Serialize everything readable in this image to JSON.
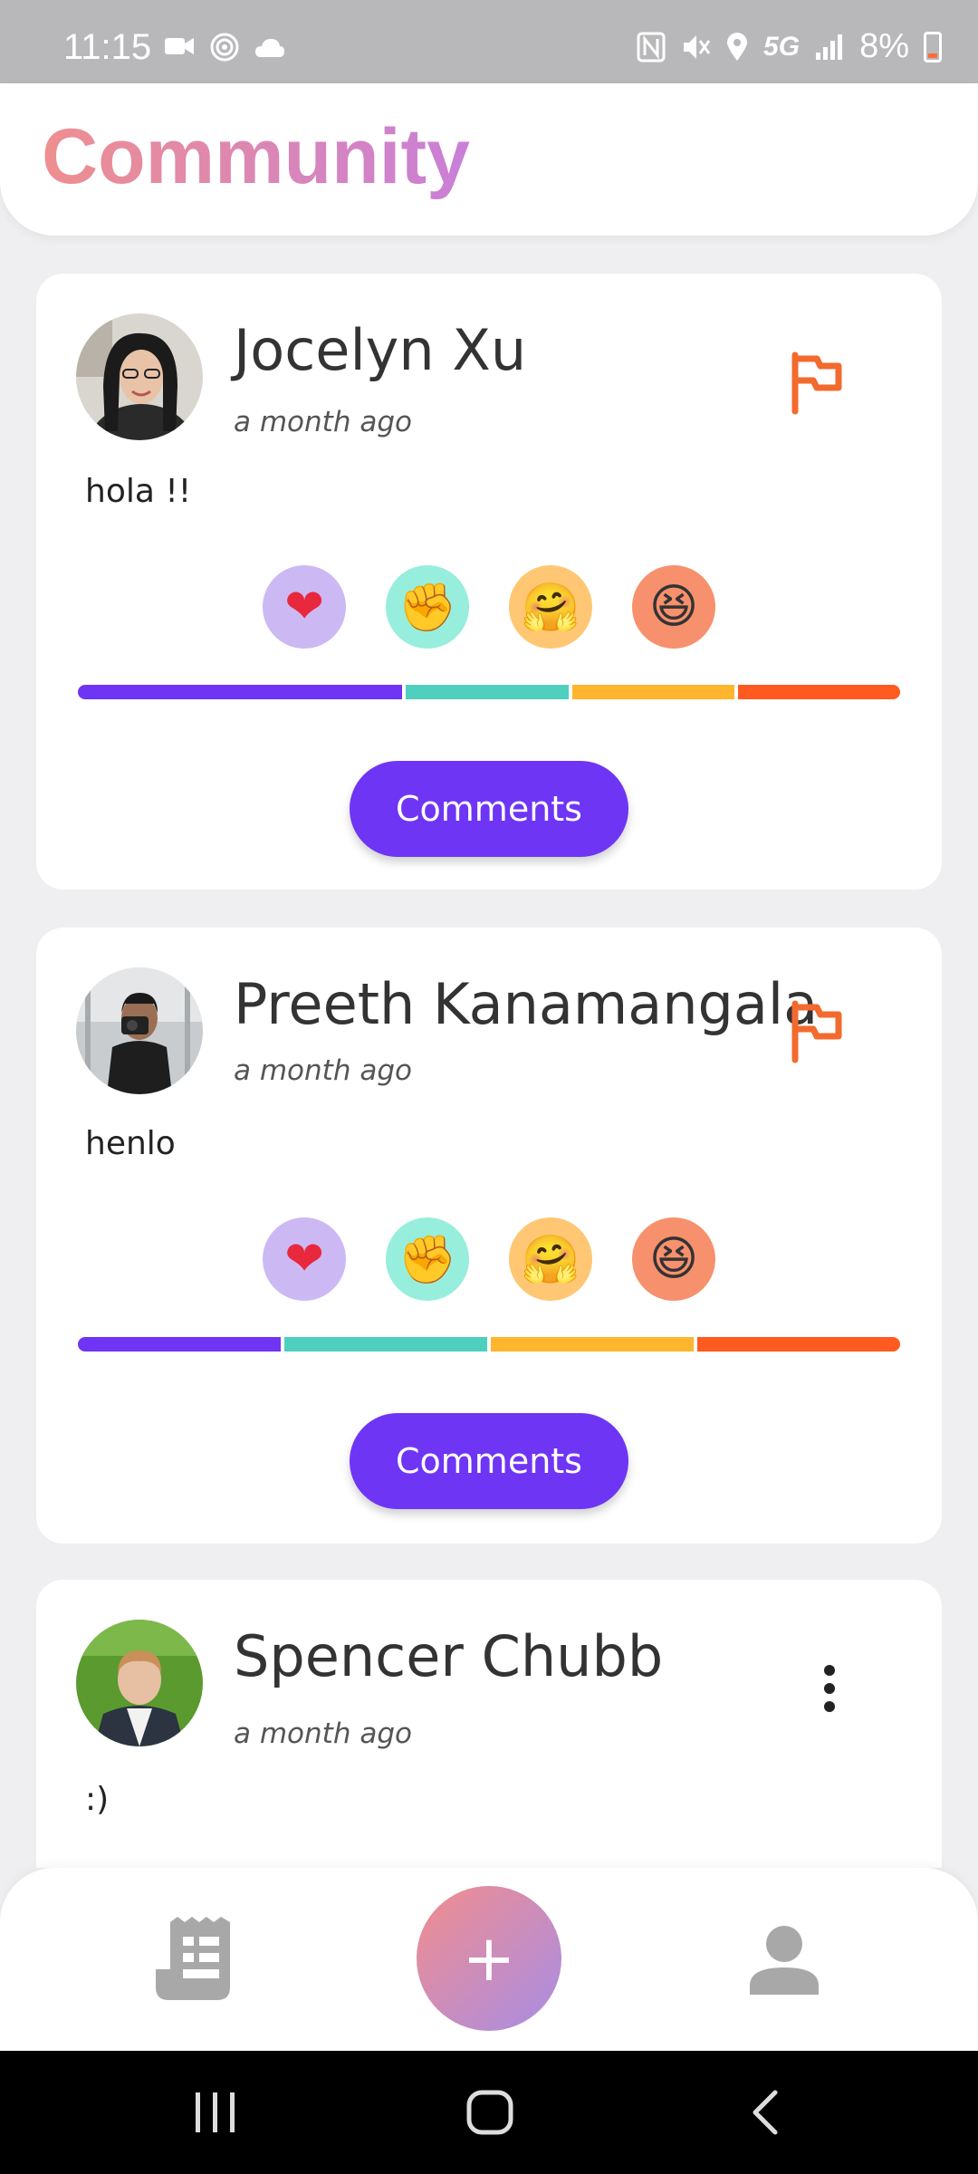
{
  "status_bar": {
    "time": "11:15",
    "battery": "8%",
    "network": "5G",
    "icons": [
      "video-message-icon",
      "nfc-signal-icon",
      "cloud-icon",
      "nfc-icon",
      "mute-icon",
      "location-icon",
      "signal-icon",
      "battery-icon"
    ]
  },
  "header": {
    "title": "Community"
  },
  "posts": [
    {
      "name": "Jocelyn Xu",
      "time": "a month ago",
      "text": "hola !!",
      "action_icon": "flag-icon",
      "reactions": [
        "heart",
        "fist",
        "hug",
        "laugh"
      ],
      "reaction_split": [
        0.4,
        0.2,
        0.2,
        0.2
      ],
      "comments_label": "Comments"
    },
    {
      "name": "Preeth Kanamangala",
      "time": "a month ago",
      "text": "henlo",
      "action_icon": "flag-icon",
      "reactions": [
        "heart",
        "fist",
        "hug",
        "laugh"
      ],
      "reaction_split": [
        0.25,
        0.25,
        0.25,
        0.25
      ],
      "comments_label": "Comments"
    },
    {
      "name": "Spencer Chubb",
      "time": "a month ago",
      "text": ":)",
      "action_icon": "more-vertical-icon"
    }
  ],
  "colors": {
    "purple": "#6e35f5",
    "teal": "#4fcfbd",
    "amber": "#ffb52e",
    "orange": "#ff5a1f",
    "flag": "#f26a2e",
    "heart_bg": "#ccb9f4",
    "fist_bg": "#97eedc",
    "hug_bg": "#ffc773",
    "laugh_bg": "#f7906d"
  },
  "bottom_nav": {
    "items": [
      "feed-icon",
      "add-post-button",
      "profile-icon"
    ],
    "fab_label": "+"
  }
}
